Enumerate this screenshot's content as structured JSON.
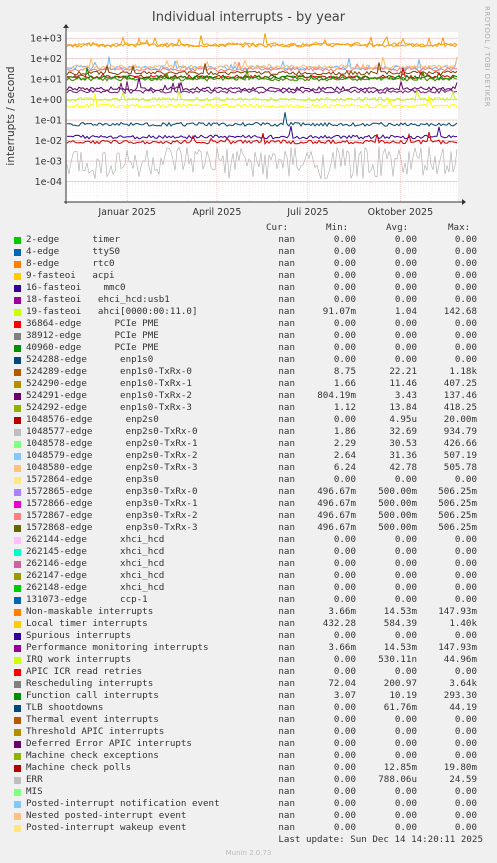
{
  "title": "Individual interrupts - by year",
  "side_label": "RRDTOOL / TOBI OETIKER",
  "chart_data": {
    "type": "line",
    "ylabel": "interrupts / second",
    "yscale": "log",
    "ylim": [
      1e-05,
      2000
    ],
    "y_ticks": [
      "1e+03",
      "1e+02",
      "1e+01",
      "1e+00",
      "1e-01",
      "1e-02",
      "1e-03",
      "1e-04"
    ],
    "x_ticks": [
      "Januar 2025",
      "April 2025",
      "Juli 2025",
      "Oktober 2025"
    ],
    "series_levels": [
      {
        "color": "#e8a800",
        "value": 500
      },
      {
        "color": "#ff9a1a",
        "value": 450
      },
      {
        "color": "#66bbff",
        "value": 35
      },
      {
        "color": "#ff7777",
        "value": 30
      },
      {
        "color": "#ffbb66",
        "value": 40
      },
      {
        "color": "#cc0000",
        "value": 13
      },
      {
        "color": "#008800",
        "value": 12
      },
      {
        "color": "#7c4400",
        "value": 20
      },
      {
        "color": "#448800",
        "value": 10
      },
      {
        "color": "#5a0064",
        "value": 3.4
      },
      {
        "color": "#6e1a6e",
        "value": 2.5
      },
      {
        "color": "#ccee33",
        "value": 1.04
      },
      {
        "color": "#ffff00",
        "value": 0.5
      },
      {
        "color": "#004a6e",
        "value": 0.062
      },
      {
        "color": "#330099",
        "value": 0.015
      },
      {
        "color": "#cc0000",
        "value": 0.0085
      },
      {
        "color": "#aaaaaa",
        "value": 0.0008
      }
    ]
  },
  "legend": {
    "headers": {
      "cur": "Cur:",
      "min": "Min:",
      "avg": "Avg:",
      "max": "Max:"
    },
    "rows": [
      {
        "name": "2-edge      timer",
        "color": "#00cc00",
        "cur": "nan",
        "min": "0.00",
        "avg": "0.00",
        "max": "0.00"
      },
      {
        "name": "4-edge      ttyS0",
        "color": "#0066b3",
        "cur": "nan",
        "min": "0.00",
        "avg": "0.00",
        "max": "0.00"
      },
      {
        "name": "8-edge      rtc0",
        "color": "#ff8000",
        "cur": "nan",
        "min": "0.00",
        "avg": "0.00",
        "max": "0.00"
      },
      {
        "name": "9-fasteoi   acpi",
        "color": "#ffcc00",
        "cur": "nan",
        "min": "0.00",
        "avg": "0.00",
        "max": "0.00"
      },
      {
        "name": "16-fasteoi    mmc0",
        "color": "#330099",
        "cur": "nan",
        "min": "0.00",
        "avg": "0.00",
        "max": "0.00"
      },
      {
        "name": "18-fasteoi   ehci_hcd:usb1",
        "color": "#990099",
        "cur": "nan",
        "min": "0.00",
        "avg": "0.00",
        "max": "0.00"
      },
      {
        "name": "19-fasteoi   ahci[0000:00:11.0]",
        "color": "#ccff00",
        "cur": "nan",
        "min": "91.07m",
        "avg": "1.04",
        "max": "142.68"
      },
      {
        "name": "36864-edge      PCIe PME",
        "color": "#ff0000",
        "cur": "nan",
        "min": "0.00",
        "avg": "0.00",
        "max": "0.00"
      },
      {
        "name": "38912-edge      PCIe PME",
        "color": "#808080",
        "cur": "nan",
        "min": "0.00",
        "avg": "0.00",
        "max": "0.00"
      },
      {
        "name": "40960-edge      PCIe PME",
        "color": "#008f00",
        "cur": "nan",
        "min": "0.00",
        "avg": "0.00",
        "max": "0.00"
      },
      {
        "name": "524288-edge      enp1s0",
        "color": "#00487d",
        "cur": "nan",
        "min": "0.00",
        "avg": "0.00",
        "max": "0.00"
      },
      {
        "name": "524289-edge      enp1s0-TxRx-0",
        "color": "#b35a00",
        "cur": "nan",
        "min": "8.75",
        "avg": "22.21",
        "max": "1.18k"
      },
      {
        "name": "524290-edge      enp1s0-TxRx-1",
        "color": "#b38f00",
        "cur": "nan",
        "min": "1.66",
        "avg": "11.46",
        "max": "407.25"
      },
      {
        "name": "524291-edge      enp1s0-TxRx-2",
        "color": "#6b006b",
        "cur": "nan",
        "min": "804.19m",
        "avg": "3.43",
        "max": "137.46"
      },
      {
        "name": "524292-edge      enp1s0-TxRx-3",
        "color": "#8fb300",
        "cur": "nan",
        "min": "1.12",
        "avg": "13.84",
        "max": "418.25"
      },
      {
        "name": "1048576-edge      enp2s0",
        "color": "#b30000",
        "cur": "nan",
        "min": "0.00",
        "avg": "4.95u",
        "max": "20.00m"
      },
      {
        "name": "1048577-edge      enp2s0-TxRx-0",
        "color": "#bebebe",
        "cur": "nan",
        "min": "1.86",
        "avg": "32.69",
        "max": "934.79"
      },
      {
        "name": "1048578-edge      enp2s0-TxRx-1",
        "color": "#80ff80",
        "cur": "nan",
        "min": "2.29",
        "avg": "30.53",
        "max": "426.66"
      },
      {
        "name": "1048579-edge      enp2s0-TxRx-2",
        "color": "#80c9ff",
        "cur": "nan",
        "min": "2.64",
        "avg": "31.36",
        "max": "507.19"
      },
      {
        "name": "1048580-edge      enp2s0-TxRx-3",
        "color": "#ffc080",
        "cur": "nan",
        "min": "6.24",
        "avg": "42.78",
        "max": "505.78"
      },
      {
        "name": "1572864-edge      enp3s0",
        "color": "#ffe680",
        "cur": "nan",
        "min": "0.00",
        "avg": "0.00",
        "max": "0.00"
      },
      {
        "name": "1572865-edge      enp3s0-TxRx-0",
        "color": "#aa80ff",
        "cur": "nan",
        "min": "496.67m",
        "avg": "500.00m",
        "max": "506.25m"
      },
      {
        "name": "1572866-edge      enp3s0-TxRx-1",
        "color": "#ee00cc",
        "cur": "nan",
        "min": "496.67m",
        "avg": "500.00m",
        "max": "506.25m"
      },
      {
        "name": "1572867-edge      enp3s0-TxRx-2",
        "color": "#ff8080",
        "cur": "nan",
        "min": "496.67m",
        "avg": "500.00m",
        "max": "506.25m"
      },
      {
        "name": "1572868-edge      enp3s0-TxRx-3",
        "color": "#666600",
        "cur": "nan",
        "min": "496.67m",
        "avg": "500.00m",
        "max": "506.25m"
      },
      {
        "name": "262144-edge      xhci_hcd",
        "color": "#ffbfff",
        "cur": "nan",
        "min": "0.00",
        "avg": "0.00",
        "max": "0.00"
      },
      {
        "name": "262145-edge      xhci_hcd",
        "color": "#00ffcc",
        "cur": "nan",
        "min": "0.00",
        "avg": "0.00",
        "max": "0.00"
      },
      {
        "name": "262146-edge      xhci_hcd",
        "color": "#cc6699",
        "cur": "nan",
        "min": "0.00",
        "avg": "0.00",
        "max": "0.00"
      },
      {
        "name": "262147-edge      xhci_hcd",
        "color": "#999900",
        "cur": "nan",
        "min": "0.00",
        "avg": "0.00",
        "max": "0.00"
      },
      {
        "name": "262148-edge      xhci_hcd",
        "color": "#00cc00",
        "cur": "nan",
        "min": "0.00",
        "avg": "0.00",
        "max": "0.00"
      },
      {
        "name": "131073-edge      ccp-1",
        "color": "#0066b3",
        "cur": "nan",
        "min": "0.00",
        "avg": "0.00",
        "max": "0.00"
      },
      {
        "name": "Non-maskable interrupts",
        "color": "#ff8000",
        "cur": "nan",
        "min": "3.66m",
        "avg": "14.53m",
        "max": "147.93m"
      },
      {
        "name": "Local timer interrupts",
        "color": "#ffcc00",
        "cur": "nan",
        "min": "432.28",
        "avg": "584.39",
        "max": "1.40k"
      },
      {
        "name": "Spurious interrupts",
        "color": "#330099",
        "cur": "nan",
        "min": "0.00",
        "avg": "0.00",
        "max": "0.00"
      },
      {
        "name": "Performance monitoring interrupts",
        "color": "#990099",
        "cur": "nan",
        "min": "3.66m",
        "avg": "14.53m",
        "max": "147.93m"
      },
      {
        "name": "IRQ work interrupts",
        "color": "#ccff00",
        "cur": "nan",
        "min": "0.00",
        "avg": "530.11n",
        "max": "44.96m"
      },
      {
        "name": "APIC ICR read retries",
        "color": "#ff0000",
        "cur": "nan",
        "min": "0.00",
        "avg": "0.00",
        "max": "0.00"
      },
      {
        "name": "Rescheduling interrupts",
        "color": "#808080",
        "cur": "nan",
        "min": "72.04",
        "avg": "200.97",
        "max": "3.64k"
      },
      {
        "name": "Function call interrupts",
        "color": "#008f00",
        "cur": "nan",
        "min": "3.07",
        "avg": "10.19",
        "max": "293.30"
      },
      {
        "name": "TLB shootdowns",
        "color": "#00487d",
        "cur": "nan",
        "min": "0.00",
        "avg": "61.76m",
        "max": "44.19"
      },
      {
        "name": "Thermal event interrupts",
        "color": "#b35a00",
        "cur": "nan",
        "min": "0.00",
        "avg": "0.00",
        "max": "0.00"
      },
      {
        "name": "Threshold APIC interrupts",
        "color": "#b38f00",
        "cur": "nan",
        "min": "0.00",
        "avg": "0.00",
        "max": "0.00"
      },
      {
        "name": "Deferred Error APIC interrupts",
        "color": "#6b006b",
        "cur": "nan",
        "min": "0.00",
        "avg": "0.00",
        "max": "0.00"
      },
      {
        "name": "Machine check exceptions",
        "color": "#8fb300",
        "cur": "nan",
        "min": "0.00",
        "avg": "0.00",
        "max": "0.00"
      },
      {
        "name": "Machine check polls",
        "color": "#b30000",
        "cur": "nan",
        "min": "0.00",
        "avg": "12.85m",
        "max": "19.80m"
      },
      {
        "name": "ERR",
        "color": "#bebebe",
        "cur": "nan",
        "min": "0.00",
        "avg": "788.06u",
        "max": "24.59"
      },
      {
        "name": "MIS",
        "color": "#80ff80",
        "cur": "nan",
        "min": "0.00",
        "avg": "0.00",
        "max": "0.00"
      },
      {
        "name": "Posted-interrupt notification event",
        "color": "#80c9ff",
        "cur": "nan",
        "min": "0.00",
        "avg": "0.00",
        "max": "0.00"
      },
      {
        "name": "Nested posted-interrupt event",
        "color": "#ffc080",
        "cur": "nan",
        "min": "0.00",
        "avg": "0.00",
        "max": "0.00"
      },
      {
        "name": "Posted-interrupt wakeup event",
        "color": "#ffe680",
        "cur": "nan",
        "min": "0.00",
        "avg": "0.00",
        "max": "0.00"
      }
    ]
  },
  "footer": "Last update: Sun Dec 14 14:20:11 2025",
  "munin": "Munin 2.0.73"
}
